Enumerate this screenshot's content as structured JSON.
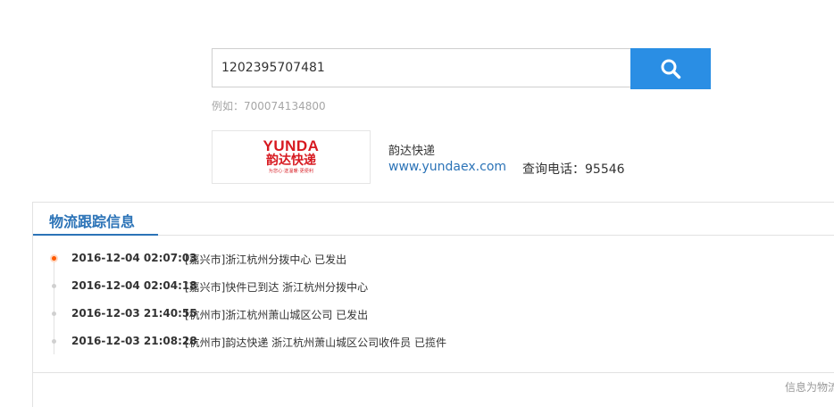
{
  "search": {
    "value": "1202395707481",
    "example_text": "例如：700074134800"
  },
  "company": {
    "logo_text_en": "YUNDA",
    "logo_text_cn": "韵达快递",
    "logo_slogan": "为您心·送温暖·更便利",
    "name": "韵达快递",
    "website": "www.yundaex.com",
    "phone_text": "查询电话：95546"
  },
  "tracking": {
    "title": "物流跟踪信息",
    "events": [
      {
        "time": "2016-12-04 02:07:03",
        "desc": "[嘉兴市]浙江杭州分拨中心 已发出"
      },
      {
        "time": "2016-12-04 02:04:18",
        "desc": "[嘉兴市]快件已到达 浙江杭州分拨中心"
      },
      {
        "time": "2016-12-03 21:40:55",
        "desc": "[杭州市]浙江杭州萧山城区公司 已发出"
      },
      {
        "time": "2016-12-03 21:08:28",
        "desc": "[杭州市]韵达快递 浙江杭州萧山城区公司收件员 已揽件"
      }
    ]
  },
  "footer": {
    "note": "信息为物流"
  },
  "colors": {
    "accent": "#2a8ee4",
    "link": "#2b73b7",
    "brand_red": "#d71920",
    "active_dot": "#ff5a00"
  },
  "icons": {
    "search_button": "search-icon"
  }
}
